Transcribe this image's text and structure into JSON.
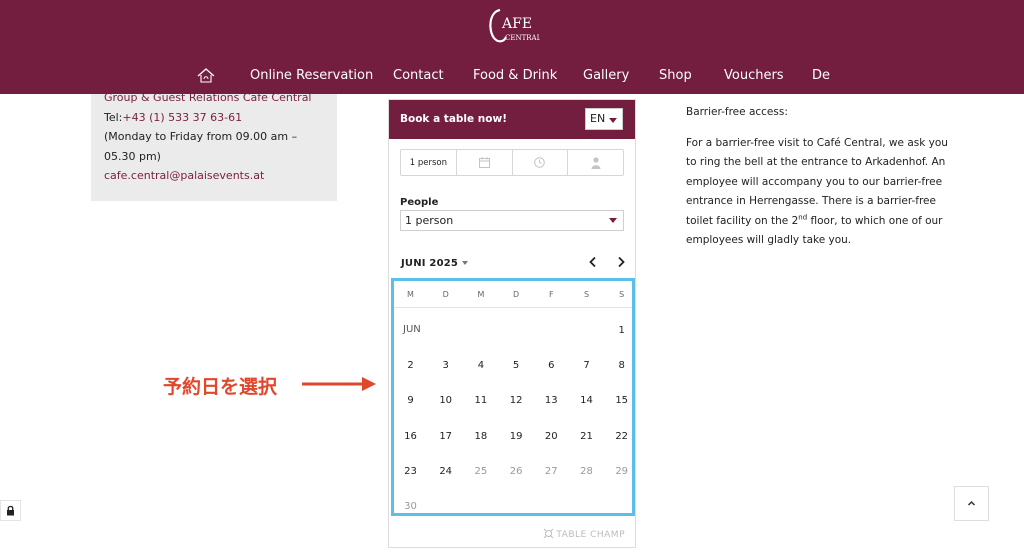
{
  "logo": {
    "line1": "AFE",
    "line2": "CENTRAL"
  },
  "nav": {
    "items": [
      "Online Reservation",
      "Contact",
      "Food & Drink",
      "Gallery",
      "Shop",
      "Vouchers",
      "De"
    ]
  },
  "contact": {
    "line1": "Group & Guest Relations Cafe Central",
    "tel_label": "Tel:",
    "tel_value": "+43 (1) 533 37 63-61",
    "hours": "(Monday to Friday from 09.00 am – 05.30 pm)",
    "email": "cafe.central@palaisevents.at"
  },
  "widget": {
    "title": "Book a table now!",
    "language": "EN",
    "step_people": "1 person",
    "people_label": "People",
    "people_value": "1 person",
    "month": "JUNI 2025",
    "month_tag": "JUN",
    "weekdays": [
      "M",
      "D",
      "M",
      "D",
      "F",
      "S",
      "S"
    ],
    "first_weekday_index": 6,
    "days": [
      1,
      2,
      3,
      4,
      5,
      6,
      7,
      8,
      9,
      10,
      11,
      12,
      13,
      14,
      15,
      16,
      17,
      18,
      19,
      20,
      21,
      22,
      23,
      24,
      25,
      26,
      27,
      28,
      29,
      30
    ],
    "first_unavailable_day": 25,
    "brand": "TABLE CHAMP"
  },
  "annotation": {
    "text": "予約日を選択"
  },
  "info": {
    "title": "Barrier-free access:",
    "para_before_sup": "For a barrier-free visit to Café Central, we ask you to ring the bell at the entrance to Arkadenhof. An employee will accompany you to our barrier-free entrance in Herrengasse. There is a barrier-free toilet facility on the 2",
    "sup": "nd",
    "para_after_sup": " floor, to which one of our employees will gladly take you."
  },
  "colors": {
    "brand": "#731d3f",
    "highlight": "#5bbfe8",
    "annotation": "#e2462b"
  }
}
